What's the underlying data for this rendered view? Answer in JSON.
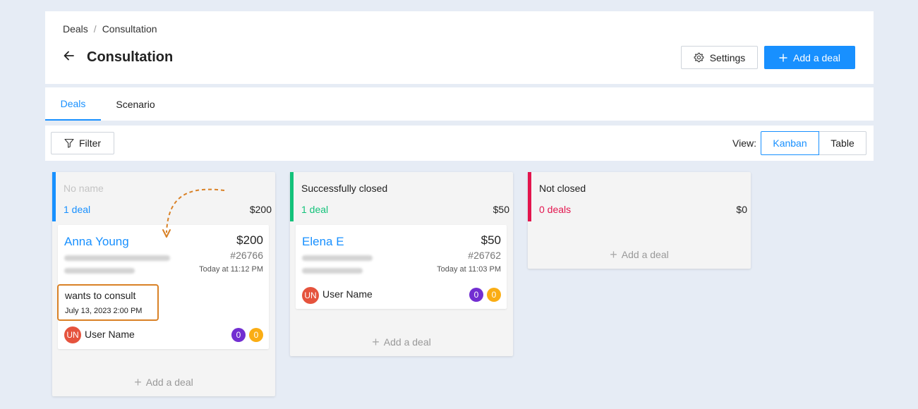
{
  "breadcrumb": {
    "parent": "Deals",
    "separator": "/",
    "current": "Consultation"
  },
  "header": {
    "title": "Consultation",
    "settings_label": "Settings",
    "add_label": "Add a deal"
  },
  "tabs": [
    {
      "label": "Deals",
      "active": true
    },
    {
      "label": "Scenario",
      "active": false
    }
  ],
  "toolbar": {
    "filter_label": "Filter",
    "view_label": "View:",
    "view_options": [
      "Kanban",
      "Table"
    ],
    "view_selected": "Kanban"
  },
  "columns": [
    {
      "name": "No name",
      "count": "1 deal",
      "sum": "$200",
      "color": "#1890ff",
      "count_color": "#1890ff",
      "add_label": "Add a deal",
      "cards": [
        {
          "name": "Anna Young",
          "price": "$200",
          "id": "#26766",
          "time": "Today at 11:12 PM",
          "note": "wants to consult",
          "note_date": "July 13, 2023 2:00 PM",
          "avatar": "UN",
          "user": "User Name",
          "badge1": "0",
          "badge2": "0"
        }
      ]
    },
    {
      "name": "Successfully closed",
      "count": "1 deal",
      "sum": "$50",
      "color": "#13c27a",
      "count_color": "#13c27a",
      "add_label": "Add a deal",
      "cards": [
        {
          "name": "Elena E",
          "price": "$50",
          "id": "#26762",
          "time": "Today at 11:03 PM",
          "avatar": "UN",
          "user": "User Name",
          "badge1": "0",
          "badge2": "0"
        }
      ]
    },
    {
      "name": "Not closed",
      "count": "0 deals",
      "sum": "$0",
      "color": "#e3154e",
      "count_color": "#e3154e",
      "add_label": "Add a deal",
      "cards": []
    }
  ]
}
